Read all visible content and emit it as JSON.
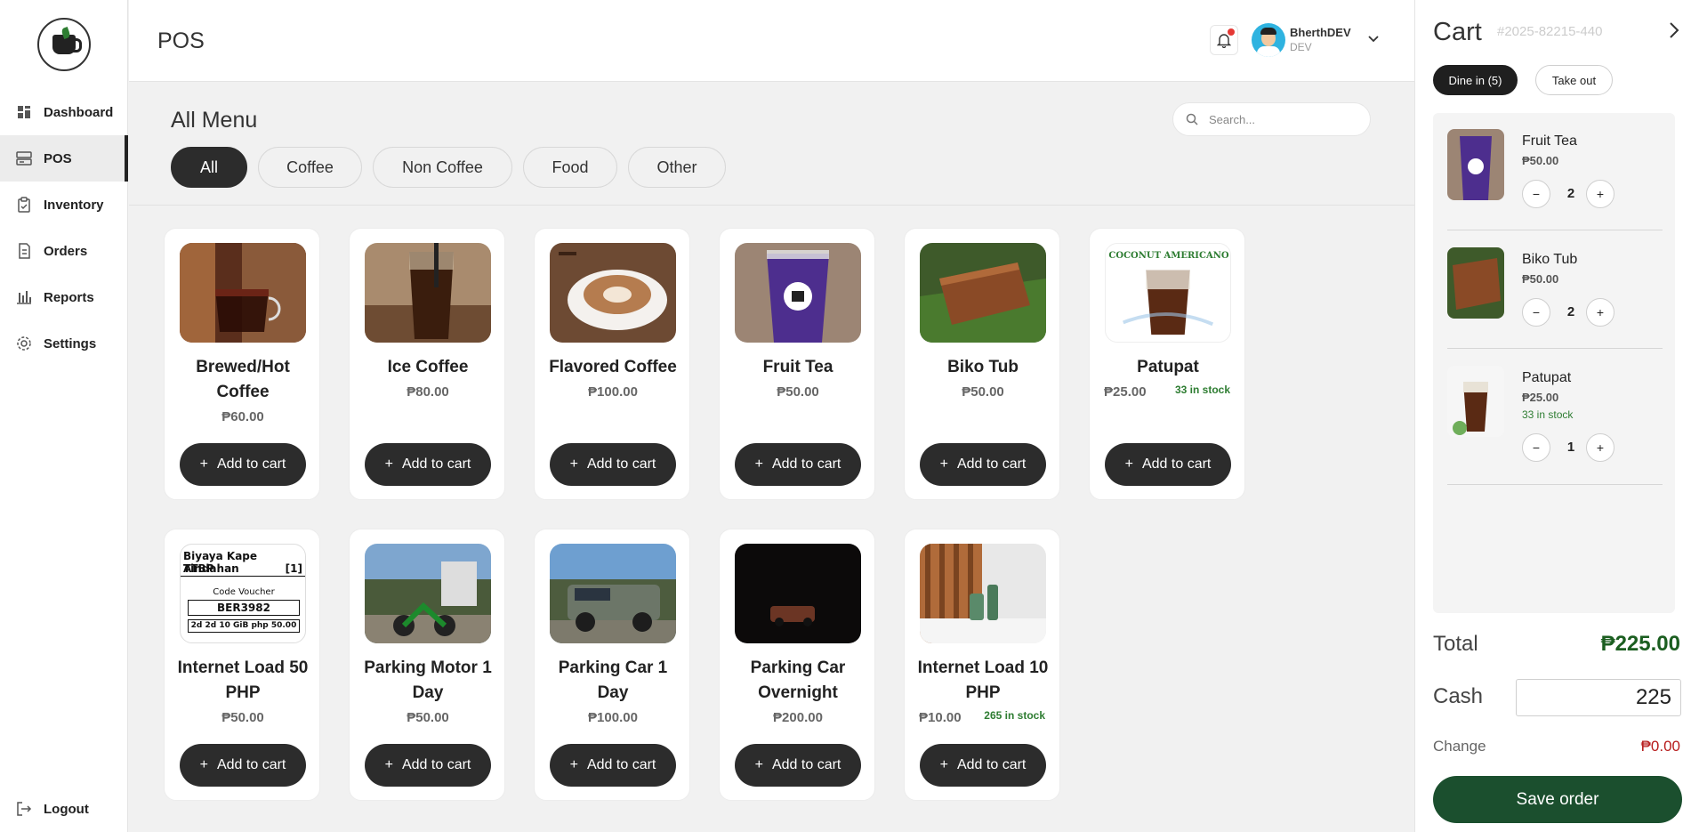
{
  "sidebar": {
    "items": [
      {
        "label": "Dashboard",
        "icon": "dashboard-icon"
      },
      {
        "label": "POS",
        "icon": "pos-icon"
      },
      {
        "label": "Inventory",
        "icon": "inventory-icon"
      },
      {
        "label": "Orders",
        "icon": "orders-icon"
      },
      {
        "label": "Reports",
        "icon": "reports-icon"
      },
      {
        "label": "Settings",
        "icon": "settings-icon"
      }
    ],
    "logout": "Logout",
    "active": "POS"
  },
  "header": {
    "title": "POS",
    "user_name": "BherthDEV",
    "user_role": "DEV"
  },
  "main": {
    "title": "All Menu",
    "search_placeholder": "Search...",
    "filters": [
      "All",
      "Coffee",
      "Non Coffee",
      "Food",
      "Other"
    ],
    "active_filter": "All",
    "add_label": "Add to cart",
    "products": [
      {
        "name": "Brewed/Hot Coffee",
        "price": "₱60.00",
        "stock": ""
      },
      {
        "name": "Ice Coffee",
        "price": "₱80.00",
        "stock": ""
      },
      {
        "name": "Flavored Coffee",
        "price": "₱100.00",
        "stock": ""
      },
      {
        "name": "Fruit Tea",
        "price": "₱50.00",
        "stock": ""
      },
      {
        "name": "Biko Tub",
        "price": "₱50.00",
        "stock": ""
      },
      {
        "name": "Patupat",
        "price": "₱25.00",
        "stock": "33 in stock",
        "image_text": "COCONUT AMERICANO"
      },
      {
        "name": "Internet Load 50 PHP",
        "price": "₱50.00",
        "stock": "",
        "voucher": {
          "line1": "Biyaya Kape Tindahan",
          "line2": "ATBP",
          "line2b": "[1]",
          "line3": "Code Voucher",
          "code": "BER3982",
          "line5": "2d 2d 10 GiB php 50.00"
        }
      },
      {
        "name": "Parking Motor 1 Day",
        "price": "₱50.00",
        "stock": ""
      },
      {
        "name": "Parking Car 1 Day",
        "price": "₱100.00",
        "stock": ""
      },
      {
        "name": "Parking Car Overnight",
        "price": "₱200.00",
        "stock": ""
      },
      {
        "name": "Internet Load 10 PHP",
        "price": "₱10.00",
        "stock": "265 in stock"
      }
    ]
  },
  "cart": {
    "title": "Cart",
    "order_id": "#2025-82215-440",
    "dine_in": "Dine in (5)",
    "take_out": "Take out",
    "items": [
      {
        "name": "Fruit Tea",
        "price": "₱50.00",
        "qty": "2",
        "stock": ""
      },
      {
        "name": "Biko Tub",
        "price": "₱50.00",
        "qty": "2",
        "stock": ""
      },
      {
        "name": "Patupat",
        "price": "₱25.00",
        "qty": "1",
        "stock": "33 in stock"
      }
    ],
    "total_label": "Total",
    "total_value": "₱225.00",
    "cash_label": "Cash",
    "cash_value": "225",
    "change_label": "Change",
    "change_value": "₱0.00",
    "save_label": "Save order"
  },
  "colors": {
    "accent_dark": "#2c2c2c",
    "save_green": "#1b4f2e",
    "total_green": "#1b5e20",
    "stock_green": "#2e7d32",
    "change_red": "#b71c1c",
    "notification_red": "#e53935"
  }
}
